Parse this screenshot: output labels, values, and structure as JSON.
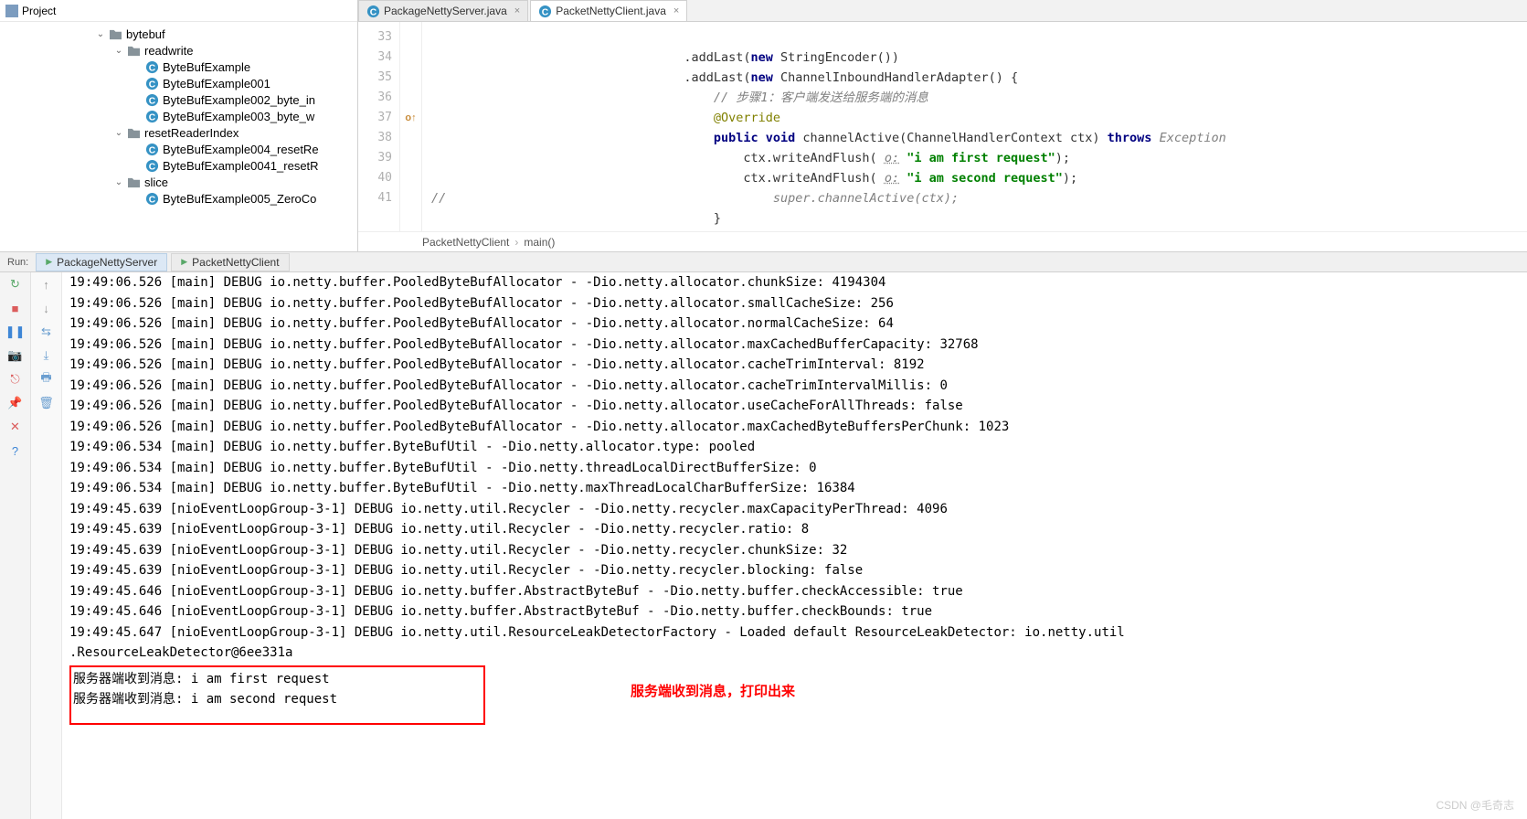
{
  "project": {
    "title": "Project",
    "tree": [
      {
        "indent": 1,
        "exp": true,
        "type": "folder",
        "label": "bytebuf"
      },
      {
        "indent": 2,
        "exp": true,
        "type": "folder",
        "label": "readwrite"
      },
      {
        "indent": 3,
        "exp": null,
        "type": "class",
        "label": "ByteBufExample"
      },
      {
        "indent": 3,
        "exp": null,
        "type": "class",
        "label": "ByteBufExample001"
      },
      {
        "indent": 3,
        "exp": null,
        "type": "class",
        "label": "ByteBufExample002_byte_in"
      },
      {
        "indent": 3,
        "exp": null,
        "type": "class",
        "label": "ByteBufExample003_byte_w"
      },
      {
        "indent": 2,
        "exp": true,
        "type": "folder",
        "label": "resetReaderIndex"
      },
      {
        "indent": 3,
        "exp": null,
        "type": "class",
        "label": "ByteBufExample004_resetRe"
      },
      {
        "indent": 3,
        "exp": null,
        "type": "class",
        "label": "ByteBufExample0041_resetR"
      },
      {
        "indent": 2,
        "exp": true,
        "type": "folder",
        "label": "slice"
      },
      {
        "indent": 3,
        "exp": null,
        "type": "class",
        "label": "ByteBufExample005_ZeroCo"
      }
    ]
  },
  "tabs": [
    {
      "label": "PackageNettyServer.java",
      "active": false
    },
    {
      "label": "PacketNettyClient.java",
      "active": true
    }
  ],
  "gutter": {
    "lines": [
      33,
      34,
      35,
      36,
      37,
      38,
      39,
      40,
      41
    ],
    "override_line": 37
  },
  "code": {
    "l33_a": ".addLast(",
    "l33_b": "new",
    "l33_c": " StringEncoder())",
    "l34_a": ".addLast(",
    "l34_b": "new",
    "l34_c": " ChannelInboundHandlerAdapter() {",
    "l35": "// 步骤1：客户端发送给服务端的消息",
    "l36": "@Override",
    "l37_a": "public",
    "l37_b": " void",
    "l37_c": " channelActive",
    "l37_d": "(ChannelHandlerContext ctx) ",
    "l37_e": "throws",
    "l37_f": " Exception",
    "l38_a": "ctx.writeAndFlush( ",
    "l38_b": "o:",
    "l38_c": " \"i am first request\"",
    "l38_d": ");",
    "l39_a": "ctx.writeAndFlush( ",
    "l39_b": "o:",
    "l39_c": " \"i am second request\"",
    "l39_d": ");",
    "l40": "super.channelActive(ctx);",
    "l41": "}",
    "l40_cmt": "//"
  },
  "breadcrumb": {
    "a": "PacketNettyClient",
    "b": "main()"
  },
  "run": {
    "label": "Run:",
    "tabs": [
      {
        "label": "PackageNettyServer",
        "active": true
      },
      {
        "label": "PacketNettyClient",
        "active": false
      }
    ]
  },
  "console_lines": [
    "19:49:06.526 [main] DEBUG io.netty.buffer.PooledByteBufAllocator - -Dio.netty.allocator.chunkSize: 4194304",
    "19:49:06.526 [main] DEBUG io.netty.buffer.PooledByteBufAllocator - -Dio.netty.allocator.smallCacheSize: 256",
    "19:49:06.526 [main] DEBUG io.netty.buffer.PooledByteBufAllocator - -Dio.netty.allocator.normalCacheSize: 64",
    "19:49:06.526 [main] DEBUG io.netty.buffer.PooledByteBufAllocator - -Dio.netty.allocator.maxCachedBufferCapacity: 32768",
    "19:49:06.526 [main] DEBUG io.netty.buffer.PooledByteBufAllocator - -Dio.netty.allocator.cacheTrimInterval: 8192",
    "19:49:06.526 [main] DEBUG io.netty.buffer.PooledByteBufAllocator - -Dio.netty.allocator.cacheTrimIntervalMillis: 0",
    "19:49:06.526 [main] DEBUG io.netty.buffer.PooledByteBufAllocator - -Dio.netty.allocator.useCacheForAllThreads: false",
    "19:49:06.526 [main] DEBUG io.netty.buffer.PooledByteBufAllocator - -Dio.netty.allocator.maxCachedByteBuffersPerChunk: 1023",
    "19:49:06.534 [main] DEBUG io.netty.buffer.ByteBufUtil - -Dio.netty.allocator.type: pooled",
    "19:49:06.534 [main] DEBUG io.netty.buffer.ByteBufUtil - -Dio.netty.threadLocalDirectBufferSize: 0",
    "19:49:06.534 [main] DEBUG io.netty.buffer.ByteBufUtil - -Dio.netty.maxThreadLocalCharBufferSize: 16384",
    "19:49:45.639 [nioEventLoopGroup-3-1] DEBUG io.netty.util.Recycler - -Dio.netty.recycler.maxCapacityPerThread: 4096",
    "19:49:45.639 [nioEventLoopGroup-3-1] DEBUG io.netty.util.Recycler - -Dio.netty.recycler.ratio: 8",
    "19:49:45.639 [nioEventLoopGroup-3-1] DEBUG io.netty.util.Recycler - -Dio.netty.recycler.chunkSize: 32",
    "19:49:45.639 [nioEventLoopGroup-3-1] DEBUG io.netty.util.Recycler - -Dio.netty.recycler.blocking: false",
    "19:49:45.646 [nioEventLoopGroup-3-1] DEBUG io.netty.buffer.AbstractByteBuf - -Dio.netty.buffer.checkAccessible: true",
    "19:49:45.646 [nioEventLoopGroup-3-1] DEBUG io.netty.buffer.AbstractByteBuf - -Dio.netty.buffer.checkBounds: true",
    "19:49:45.647 [nioEventLoopGroup-3-1] DEBUG io.netty.util.ResourceLeakDetectorFactory - Loaded default ResourceLeakDetector: io.netty.util",
    ".ResourceLeakDetector@6ee331a"
  ],
  "highlight_lines": [
    "服务器端收到消息: i am first request",
    "服务器端收到消息: i am second request"
  ],
  "annotation": "服务端收到消息，打印出来",
  "watermark": "CSDN @毛奇志",
  "toolbar_icons": {
    "rerun": "↻",
    "stop": "■",
    "pause": "❚❚",
    "up": "↑",
    "down": "↓",
    "wrap": "⇆",
    "scroll": "⤓",
    "print": "🖶",
    "camera": "📷",
    "trash": "🗑",
    "pin": "📌",
    "close": "✕",
    "help": "?"
  }
}
